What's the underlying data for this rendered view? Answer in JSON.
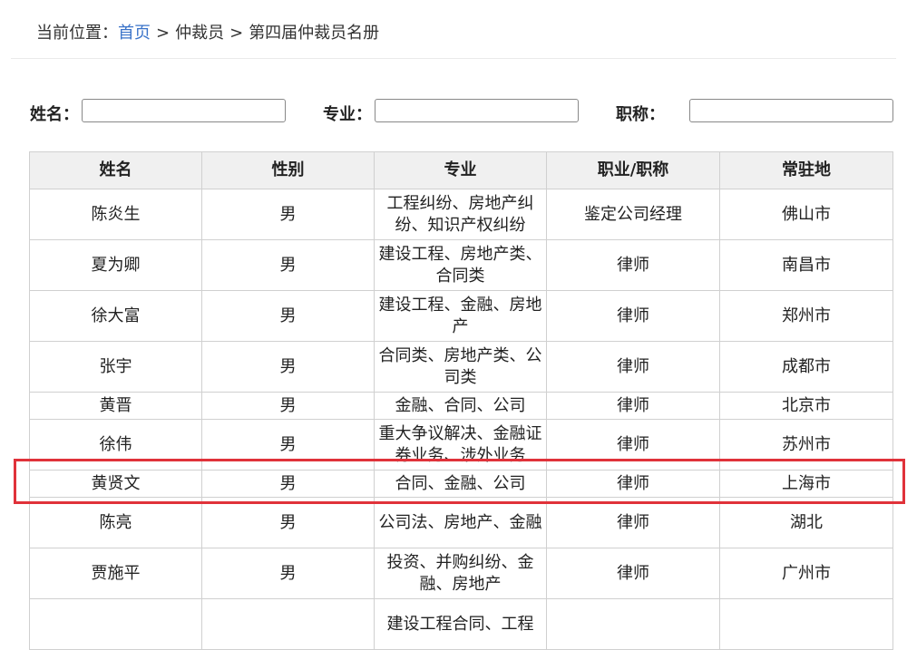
{
  "breadcrumb": {
    "prefix": "当前位置：",
    "home": "首页",
    "separator": ">",
    "level1": "仲裁员",
    "level2": "第四届仲裁员名册"
  },
  "filters": {
    "name_label": "姓名：",
    "major_label": "专业：",
    "title_label": "职称："
  },
  "table": {
    "headers": [
      "姓名",
      "性别",
      "专业",
      "职业/职称",
      "常驻地"
    ],
    "rows": [
      {
        "name": "陈炎生",
        "gender": "男",
        "major": "工程纠纷、房地产纠纷、知识产权纠纷",
        "title": "鉴定公司经理",
        "city": "佛山市"
      },
      {
        "name": "夏为卿",
        "gender": "男",
        "major": "建设工程、房地产类、合同类",
        "title": "律师",
        "city": "南昌市"
      },
      {
        "name": "徐大富",
        "gender": "男",
        "major": "建设工程、金融、房地产",
        "title": "律师",
        "city": "郑州市"
      },
      {
        "name": "张宇",
        "gender": "男",
        "major": "合同类、房地产类、公司类",
        "title": "律师",
        "city": "成都市"
      },
      {
        "name": "黄晋",
        "gender": "男",
        "major": "金融、合同、公司",
        "title": "律师",
        "city": "北京市"
      },
      {
        "name": "徐伟",
        "gender": "男",
        "major": "重大争议解决、金融证券业务、涉外业务",
        "title": "律师",
        "city": "苏州市"
      },
      {
        "name": "黄贤文",
        "gender": "男",
        "major": "合同、金融、公司",
        "title": "律师",
        "city": "上海市"
      },
      {
        "name": "陈亮",
        "gender": "男",
        "major": "公司法、房地产、金融",
        "title": "律师",
        "city": "湖北"
      },
      {
        "name": "贾施平",
        "gender": "男",
        "major": "投资、并购纠纷、金融、房地产",
        "title": "律师",
        "city": "广州市"
      },
      {
        "name": "",
        "gender": "",
        "major": "建设工程合同、工程",
        "title": "",
        "city": ""
      }
    ]
  },
  "colors": {
    "link": "#3a73c9",
    "header_bg": "#f0f0f0",
    "highlight": "#e0323a"
  }
}
